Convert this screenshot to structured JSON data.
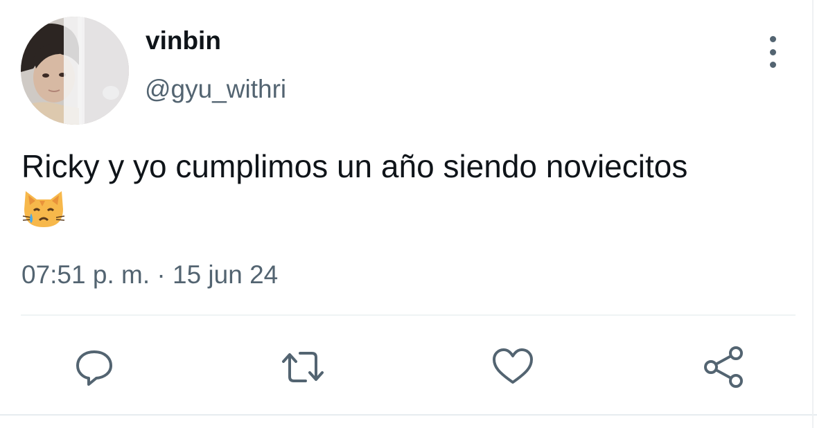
{
  "user": {
    "display_name": "vinbin",
    "handle": "@gyu_withri"
  },
  "tweet": {
    "text": "Ricky y yo cumplimos un año siendo noviecitos",
    "emoji": "crying-cat-face",
    "timestamp": "07:51 p. m. · 15 jun 24"
  },
  "actions": {
    "icons": [
      "reply-icon",
      "retweet-icon",
      "like-icon",
      "share-icon"
    ]
  },
  "colors": {
    "text_primary": "#0f1419",
    "text_secondary": "#536471",
    "divider": "#eff3f4"
  }
}
